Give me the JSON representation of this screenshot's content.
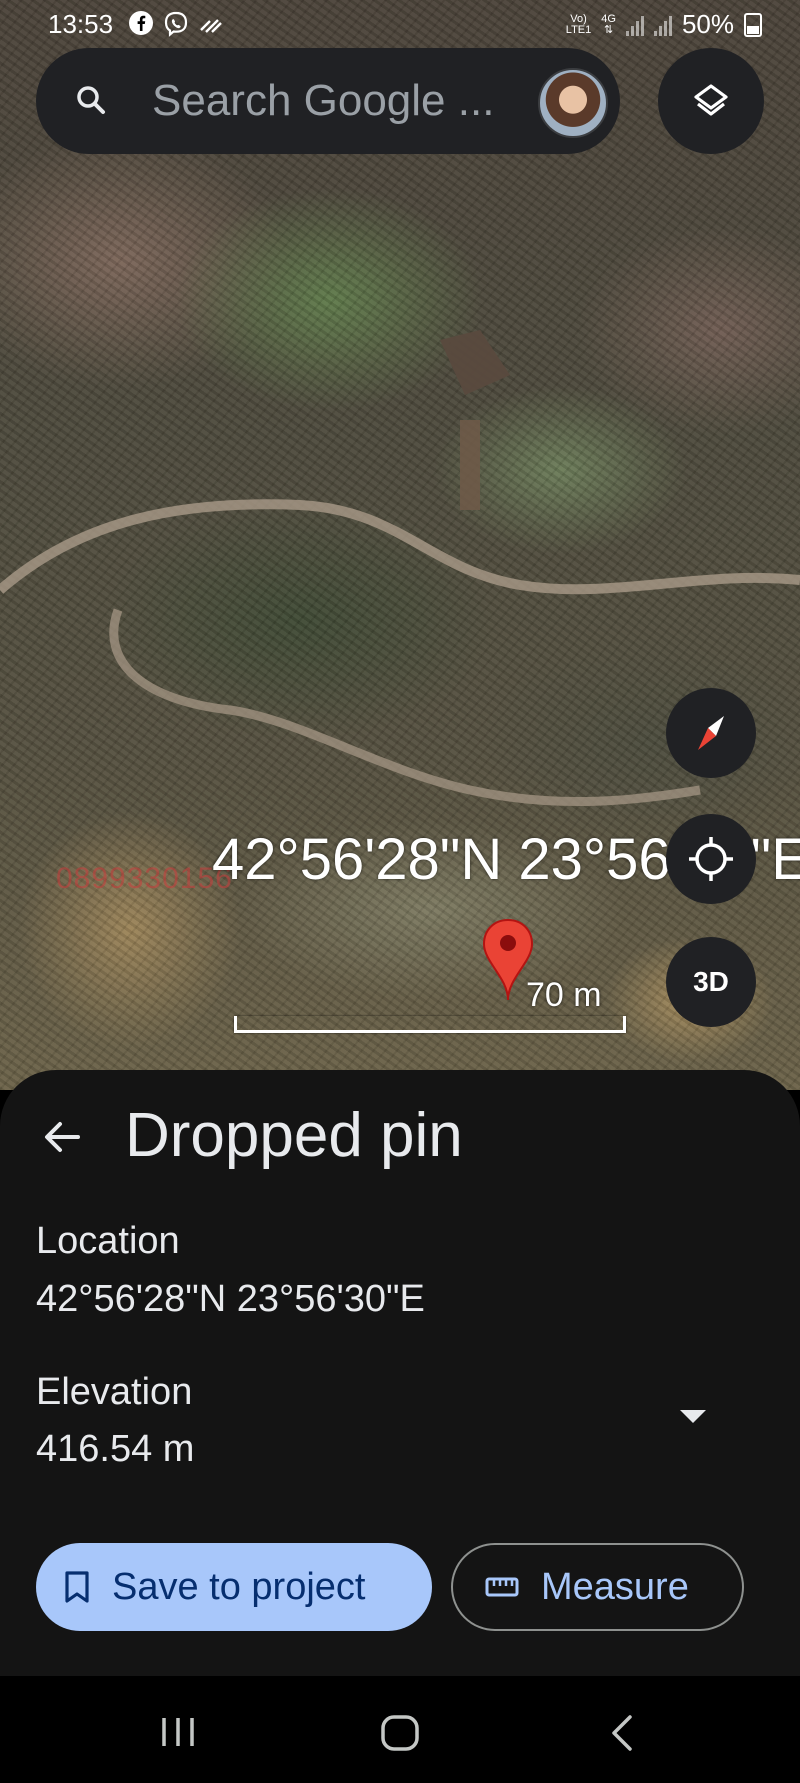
{
  "status_bar": {
    "time": "13:53",
    "network_top": "Vo)",
    "network_bottom": "LTE1",
    "network_type": "4G",
    "battery": "50%"
  },
  "search": {
    "placeholder": "Search Google ...",
    "icon": "search-icon"
  },
  "map": {
    "watermark": "0899330156",
    "coordinate_overlay": "42°56'28\"N 23°56'30\"E",
    "coordinate_overlay_visible": "42°56'28\"N 23°56",
    "coordinate_overlay_tail": "\"E",
    "scale_label": "70 m",
    "buttons": {
      "layers": "layers-icon",
      "compass": "compass-icon",
      "my_location": "crosshair-icon",
      "three_d": "3D"
    },
    "pin_color": "#ea4335"
  },
  "sheet": {
    "title": "Dropped pin",
    "location_label": "Location",
    "location_value": "42°56'28\"N 23°56'30\"E",
    "elevation_label": "Elevation",
    "elevation_value": "416.54 m",
    "save_label": "Save to project",
    "measure_label": "Measure"
  },
  "colors": {
    "sheet_bg": "#141414",
    "primary_button": "#a8c7fa",
    "primary_button_text": "#062e6f",
    "accent_text": "#a8c7fa"
  },
  "nav_bar": {
    "recents": "recents-icon",
    "home": "home-icon",
    "back": "back-icon"
  }
}
